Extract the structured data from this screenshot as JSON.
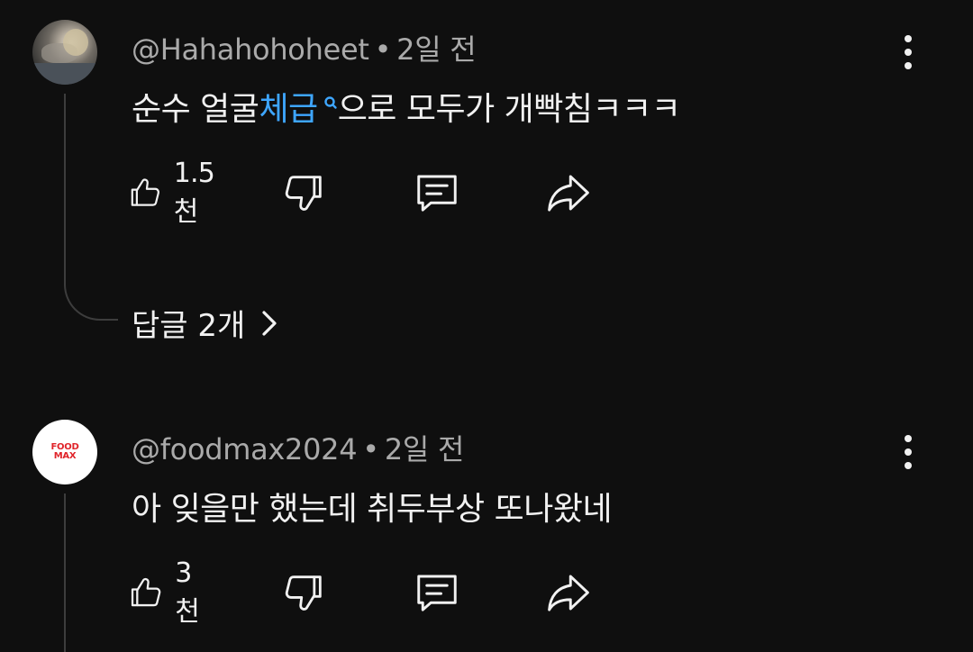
{
  "comments": [
    {
      "author": "@Hahahohoheet",
      "separator": "•",
      "time": "2일 전",
      "text_before": "순수 얼굴",
      "text_link": "체급",
      "text_after": "으로 모두가 개빡침ㅋㅋㅋ",
      "likes": "1.5천",
      "replies_label": "답글 2개",
      "avatar_icon": "user-photo-avatar",
      "link_color": "#3ea6ff"
    },
    {
      "author": "@foodmax2024",
      "separator": "•",
      "time": "2일 전",
      "text": "아 잊을만 했는데 취두부상 또나왔네",
      "likes": "3천",
      "avatar_logo_line1": "FOOD",
      "avatar_logo_line2": "MAX",
      "logo_color": "#e0242a"
    }
  ],
  "icons": {
    "like": "thumbs-up-icon",
    "dislike": "thumbs-down-icon",
    "reply": "comment-icon",
    "share": "share-icon",
    "more": "more-vertical-icon",
    "chevron": "chevron-right-icon"
  },
  "theme": {
    "background": "#0f0f0f",
    "text": "#f1f1f1",
    "meta": "#aaaaaa",
    "thread_line": "#3d3d3d"
  }
}
